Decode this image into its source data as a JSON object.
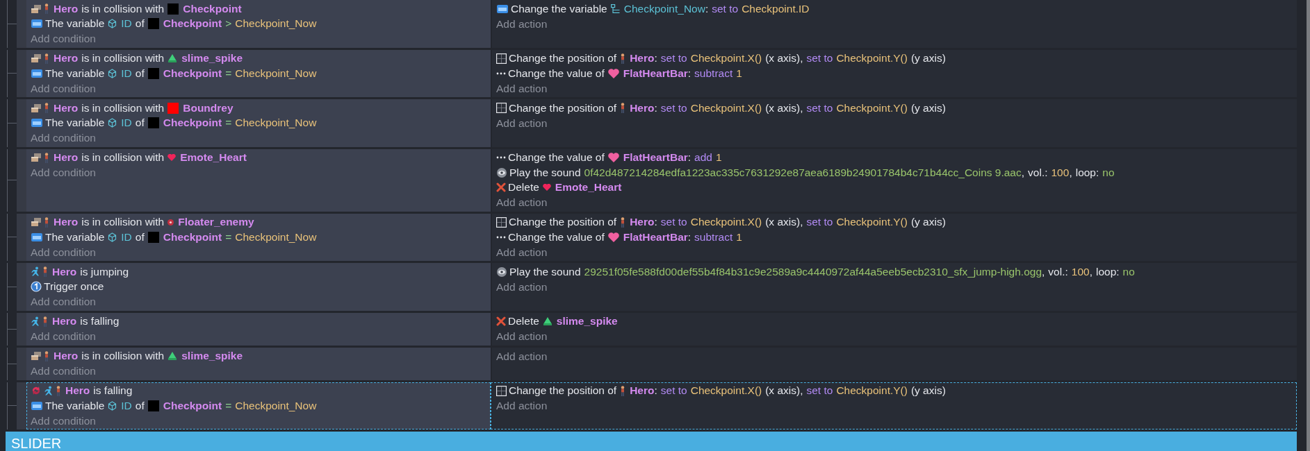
{
  "events": [
    {
      "selected": false,
      "conditions": [
        {
          "inverted": false,
          "kind": "collision",
          "parts": [
            {
              "kind": "character",
              "text": "Hero"
            },
            {
              "kind": "text",
              "text": "is in collision with"
            },
            {
              "kind": "block",
              "color": "#000000",
              "text": "Checkpoint"
            }
          ]
        },
        {
          "inverted": false,
          "kind": "variable",
          "parts": [
            {
              "kind": "text",
              "text": "The variable"
            },
            {
              "kind": "objectvar",
              "text": "ID"
            },
            {
              "kind": "text",
              "text": "of"
            },
            {
              "kind": "block",
              "color": "#000000",
              "text": "Checkpoint"
            },
            {
              "kind": "operator",
              "text": ">"
            },
            {
              "kind": "expression",
              "text": "Checkpoint_Now"
            }
          ]
        }
      ],
      "add_condition": "Add condition",
      "actions": [
        {
          "kind": "variable",
          "parts": [
            {
              "kind": "text",
              "text": "Change the variable"
            },
            {
              "kind": "scenevar",
              "text": "Checkpoint_Now"
            },
            {
              "kind": "punct",
              "text": ":"
            },
            {
              "kind": "keyword",
              "text": "set to"
            },
            {
              "kind": "expression",
              "text": "Checkpoint.ID"
            }
          ]
        }
      ],
      "add_action": "Add action"
    },
    {
      "selected": false,
      "conditions": [
        {
          "inverted": false,
          "kind": "collision",
          "parts": [
            {
              "kind": "character",
              "text": "Hero"
            },
            {
              "kind": "text",
              "text": "is in collision with"
            },
            {
              "kind": "slime",
              "text": "slime_spike"
            }
          ]
        },
        {
          "inverted": false,
          "kind": "variable",
          "parts": [
            {
              "kind": "text",
              "text": "The variable"
            },
            {
              "kind": "objectvar",
              "text": "ID"
            },
            {
              "kind": "text",
              "text": "of"
            },
            {
              "kind": "block",
              "color": "#000000",
              "text": "Checkpoint"
            },
            {
              "kind": "operator",
              "text": "="
            },
            {
              "kind": "expression",
              "text": "Checkpoint_Now"
            }
          ]
        }
      ],
      "add_condition": "Add condition",
      "actions": [
        {
          "kind": "position",
          "parts": [
            {
              "kind": "text",
              "text": "Change the position of"
            },
            {
              "kind": "character",
              "text": "Hero"
            },
            {
              "kind": "punct",
              "text": ":"
            },
            {
              "kind": "keyword",
              "text": "set to"
            },
            {
              "kind": "expression",
              "text": "Checkpoint.X()"
            },
            {
              "kind": "text",
              "text": "(x axis)"
            },
            {
              "kind": "punct",
              "text": ","
            },
            {
              "kind": "keyword",
              "text": "set to"
            },
            {
              "kind": "expression",
              "text": "Checkpoint.Y()"
            },
            {
              "kind": "text",
              "text": "(y axis)"
            }
          ]
        },
        {
          "kind": "value",
          "parts": [
            {
              "kind": "text",
              "text": "Change the value of"
            },
            {
              "kind": "bar",
              "text": "FlatHeartBar"
            },
            {
              "kind": "punct",
              "text": ":"
            },
            {
              "kind": "keyword",
              "text": "subtract"
            },
            {
              "kind": "number",
              "text": "1"
            }
          ]
        }
      ],
      "add_action": "Add action"
    },
    {
      "selected": false,
      "conditions": [
        {
          "inverted": false,
          "kind": "collision",
          "parts": [
            {
              "kind": "character",
              "text": "Hero"
            },
            {
              "kind": "text",
              "text": "is in collision with"
            },
            {
              "kind": "block",
              "color": "#ff0000",
              "text": "Boundrey"
            }
          ]
        },
        {
          "inverted": false,
          "kind": "variable",
          "parts": [
            {
              "kind": "text",
              "text": "The variable"
            },
            {
              "kind": "objectvar",
              "text": "ID"
            },
            {
              "kind": "text",
              "text": "of"
            },
            {
              "kind": "block",
              "color": "#000000",
              "text": "Checkpoint"
            },
            {
              "kind": "operator",
              "text": "="
            },
            {
              "kind": "expression",
              "text": "Checkpoint_Now"
            }
          ]
        }
      ],
      "add_condition": "Add condition",
      "actions": [
        {
          "kind": "position",
          "parts": [
            {
              "kind": "text",
              "text": "Change the position of"
            },
            {
              "kind": "character",
              "text": "Hero"
            },
            {
              "kind": "punct",
              "text": ":"
            },
            {
              "kind": "keyword",
              "text": "set to"
            },
            {
              "kind": "expression",
              "text": "Checkpoint.X()"
            },
            {
              "kind": "text",
              "text": "(x axis)"
            },
            {
              "kind": "punct",
              "text": ","
            },
            {
              "kind": "keyword",
              "text": "set to"
            },
            {
              "kind": "expression",
              "text": "Checkpoint.Y()"
            },
            {
              "kind": "text",
              "text": "(y axis)"
            }
          ]
        }
      ],
      "add_action": "Add action"
    },
    {
      "selected": false,
      "conditions": [
        {
          "inverted": false,
          "kind": "collision",
          "parts": [
            {
              "kind": "character",
              "text": "Hero"
            },
            {
              "kind": "text",
              "text": "is in collision with"
            },
            {
              "kind": "heart",
              "text": "Emote_Heart"
            }
          ]
        }
      ],
      "add_condition": "Add condition",
      "actions": [
        {
          "kind": "value",
          "parts": [
            {
              "kind": "text",
              "text": "Change the value of"
            },
            {
              "kind": "bar",
              "text": "FlatHeartBar"
            },
            {
              "kind": "punct",
              "text": ":"
            },
            {
              "kind": "keyword",
              "text": "add"
            },
            {
              "kind": "number",
              "text": "1"
            }
          ]
        },
        {
          "kind": "sound",
          "parts": [
            {
              "kind": "text",
              "text": "Play the sound"
            },
            {
              "kind": "string",
              "text": "0f42d487214284edfa1223ac335c7631292e87aea6189b24901784b4c71b44cc_Coins 9.aac"
            },
            {
              "kind": "punct",
              "text": ","
            },
            {
              "kind": "text",
              "text": "vol.:"
            },
            {
              "kind": "number",
              "text": "100"
            },
            {
              "kind": "punct",
              "text": ","
            },
            {
              "kind": "text",
              "text": "loop:"
            },
            {
              "kind": "string",
              "text": "no"
            }
          ]
        },
        {
          "kind": "delete",
          "parts": [
            {
              "kind": "text",
              "text": "Delete"
            },
            {
              "kind": "heart",
              "text": "Emote_Heart"
            }
          ]
        }
      ],
      "add_action": "Add action"
    },
    {
      "selected": false,
      "conditions": [
        {
          "inverted": false,
          "kind": "collision",
          "parts": [
            {
              "kind": "character",
              "text": "Hero"
            },
            {
              "kind": "text",
              "text": "is in collision with"
            },
            {
              "kind": "orb",
              "text": "Floater_enemy"
            }
          ]
        },
        {
          "inverted": false,
          "kind": "variable",
          "parts": [
            {
              "kind": "text",
              "text": "The variable"
            },
            {
              "kind": "objectvar",
              "text": "ID"
            },
            {
              "kind": "text",
              "text": "of"
            },
            {
              "kind": "block",
              "color": "#000000",
              "text": "Checkpoint"
            },
            {
              "kind": "operator",
              "text": "="
            },
            {
              "kind": "expression",
              "text": "Checkpoint_Now"
            }
          ]
        }
      ],
      "add_condition": "Add condition",
      "actions": [
        {
          "kind": "position",
          "parts": [
            {
              "kind": "text",
              "text": "Change the position of"
            },
            {
              "kind": "character",
              "text": "Hero"
            },
            {
              "kind": "punct",
              "text": ":"
            },
            {
              "kind": "keyword",
              "text": "set to"
            },
            {
              "kind": "expression",
              "text": "Checkpoint.X()"
            },
            {
              "kind": "text",
              "text": "(x axis)"
            },
            {
              "kind": "punct",
              "text": ","
            },
            {
              "kind": "keyword",
              "text": "set to"
            },
            {
              "kind": "expression",
              "text": "Checkpoint.Y()"
            },
            {
              "kind": "text",
              "text": "(y axis)"
            }
          ]
        },
        {
          "kind": "value",
          "parts": [
            {
              "kind": "text",
              "text": "Change the value of"
            },
            {
              "kind": "bar",
              "text": "FlatHeartBar"
            },
            {
              "kind": "punct",
              "text": ":"
            },
            {
              "kind": "keyword",
              "text": "subtract"
            },
            {
              "kind": "number",
              "text": "1"
            }
          ]
        }
      ],
      "add_action": "Add action"
    },
    {
      "selected": false,
      "conditions": [
        {
          "inverted": false,
          "kind": "movement",
          "parts": [
            {
              "kind": "character",
              "text": "Hero"
            },
            {
              "kind": "text",
              "text": "is jumping"
            }
          ]
        },
        {
          "inverted": false,
          "kind": "once",
          "parts": [
            {
              "kind": "text",
              "text": "Trigger once"
            }
          ]
        }
      ],
      "add_condition": "Add condition",
      "actions": [
        {
          "kind": "sound",
          "parts": [
            {
              "kind": "text",
              "text": "Play the sound"
            },
            {
              "kind": "string",
              "text": "29251f05fe588fd00def55b4f84b31c9e2589a9c4440972af44a5eeb5ecb2310_sfx_jump-high.ogg"
            },
            {
              "kind": "punct",
              "text": ","
            },
            {
              "kind": "text",
              "text": "vol.:"
            },
            {
              "kind": "number",
              "text": "100"
            },
            {
              "kind": "punct",
              "text": ","
            },
            {
              "kind": "text",
              "text": "loop:"
            },
            {
              "kind": "string",
              "text": "no"
            }
          ]
        }
      ],
      "add_action": "Add action"
    },
    {
      "selected": false,
      "conditions": [
        {
          "inverted": false,
          "kind": "movement",
          "parts": [
            {
              "kind": "character",
              "text": "Hero"
            },
            {
              "kind": "text",
              "text": "is falling"
            }
          ]
        }
      ],
      "add_condition": "Add condition",
      "actions": [
        {
          "kind": "delete",
          "parts": [
            {
              "kind": "text",
              "text": "Delete"
            },
            {
              "kind": "slime",
              "text": "slime_spike"
            }
          ]
        }
      ],
      "add_action": "Add action"
    },
    {
      "selected": false,
      "conditions": [
        {
          "inverted": false,
          "kind": "collision",
          "parts": [
            {
              "kind": "character",
              "text": "Hero"
            },
            {
              "kind": "text",
              "text": "is in collision with"
            },
            {
              "kind": "slime",
              "text": "slime_spike"
            }
          ]
        }
      ],
      "add_condition": "Add condition",
      "add_action": "Add action"
    },
    {
      "selected": true,
      "conditions": [
        {
          "inverted": true,
          "kind": "movement",
          "parts": [
            {
              "kind": "character",
              "text": "Hero"
            },
            {
              "kind": "text",
              "text": "is falling"
            }
          ]
        },
        {
          "inverted": false,
          "kind": "variable",
          "parts": [
            {
              "kind": "text",
              "text": "The variable"
            },
            {
              "kind": "objectvar",
              "text": "ID"
            },
            {
              "kind": "text",
              "text": "of"
            },
            {
              "kind": "block",
              "color": "#000000",
              "text": "Checkpoint"
            },
            {
              "kind": "operator",
              "text": "="
            },
            {
              "kind": "expression",
              "text": "Checkpoint_Now"
            }
          ]
        }
      ],
      "add_condition": "Add condition",
      "actions": [
        {
          "kind": "position",
          "parts": [
            {
              "kind": "text",
              "text": "Change the position of"
            },
            {
              "kind": "character",
              "text": "Hero"
            },
            {
              "kind": "punct",
              "text": ":"
            },
            {
              "kind": "keyword",
              "text": "set to"
            },
            {
              "kind": "expression",
              "text": "Checkpoint.X()"
            },
            {
              "kind": "text",
              "text": "(x axis)"
            },
            {
              "kind": "punct",
              "text": ","
            },
            {
              "kind": "keyword",
              "text": "set to"
            },
            {
              "kind": "expression",
              "text": "Checkpoint.Y()"
            },
            {
              "kind": "text",
              "text": "(y axis)"
            }
          ]
        }
      ],
      "add_action": "Add action"
    }
  ],
  "group_header": {
    "title": "SLIDER"
  }
}
